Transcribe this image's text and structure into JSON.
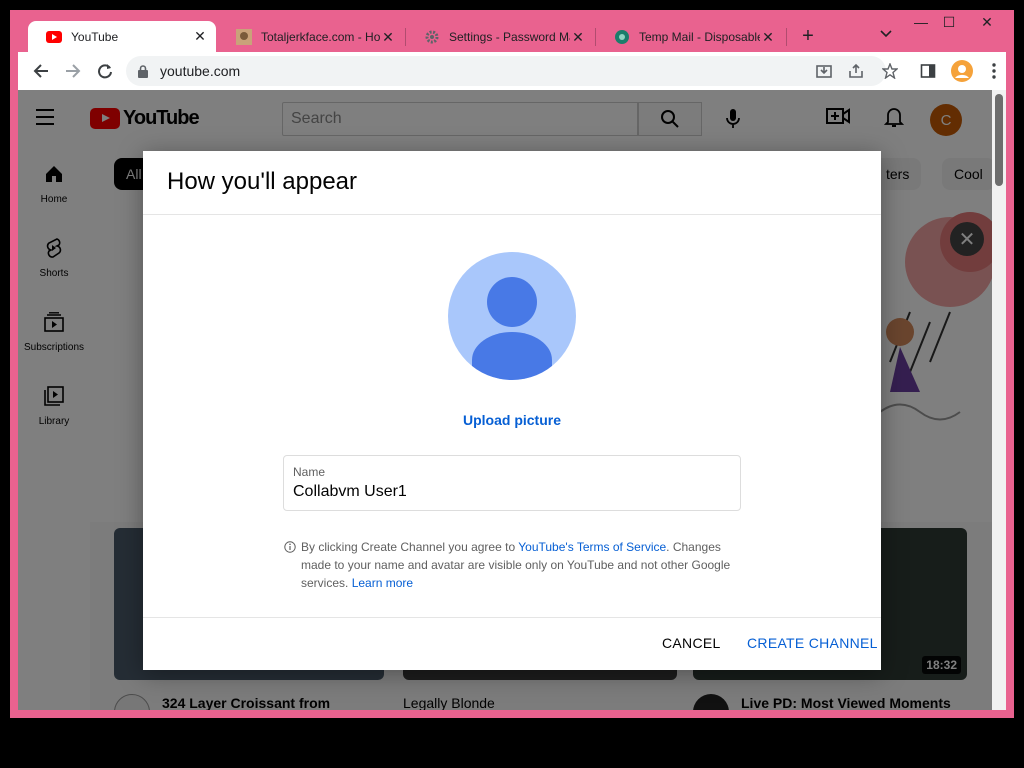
{
  "browser": {
    "tabs": [
      {
        "title": "YouTube",
        "active": true,
        "favicon": "youtube-favicon"
      },
      {
        "title": "Totaljerkface.com - Hom",
        "active": false,
        "favicon": "totaljerkface-favicon"
      },
      {
        "title": "Settings - Password Ma",
        "active": false,
        "favicon": "gear-favicon"
      },
      {
        "title": "Temp Mail - Disposable",
        "active": false,
        "favicon": "tempmail-favicon"
      }
    ],
    "url": "youtube.com",
    "accent_color": "#e9628f",
    "window_controls": {
      "minimize": "—",
      "maximize": "☐",
      "close": "✕"
    }
  },
  "youtube": {
    "logo_text": "YouTube",
    "search_placeholder": "Search",
    "avatar_letter": "C",
    "guide": [
      "Home",
      "Shorts",
      "Subscriptions",
      "Library"
    ],
    "chips": [
      "All",
      "ters",
      "Cool"
    ],
    "videos": [
      {
        "title": "324 Layer Croissant from",
        "duration": ""
      },
      {
        "title": "Legally Blonde",
        "duration": ""
      },
      {
        "title": "Live PD: Most Viewed Moments",
        "duration": "18:32"
      }
    ]
  },
  "dialog": {
    "title": "How you'll appear",
    "upload_label": "Upload picture",
    "name_label": "Name",
    "name_value": "Collabvm User1",
    "legal_prefix": "By clicking Create Channel you agree to ",
    "legal_link": "YouTube's Terms of Service",
    "legal_middle": ". Changes made to your name and avatar are visible only on YouTube and not other Google services. ",
    "learn_more": "Learn more",
    "cancel_label": "CANCEL",
    "create_label": "CREATE CHANNEL"
  }
}
